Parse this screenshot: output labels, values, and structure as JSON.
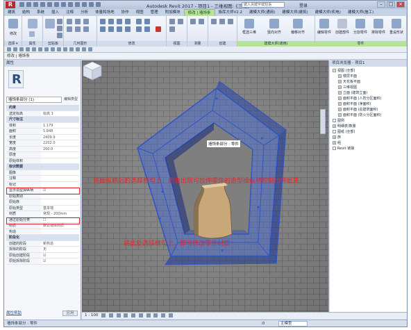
{
  "titlebar": {
    "logo": "R",
    "title": "Autodesk Revit 2017 - 项目1 - 三维视图: {三维}",
    "search_placeholder": "键入关键字或短语",
    "user": "登录",
    "min": "–",
    "max": "□",
    "close": "×"
  },
  "tabs": [
    {
      "label": "建筑",
      "active": false
    },
    {
      "label": "结构",
      "active": false
    },
    {
      "label": "系统",
      "active": false
    },
    {
      "label": "插入",
      "active": false
    },
    {
      "label": "注释",
      "active": false
    },
    {
      "label": "分析",
      "active": false
    },
    {
      "label": "体量和场地",
      "active": false
    },
    {
      "label": "协作",
      "active": false
    },
    {
      "label": "视图",
      "active": false
    },
    {
      "label": "管理",
      "active": false
    },
    {
      "label": "附加模块",
      "active": false
    },
    {
      "label": "修改 | 墙饰条",
      "active": true
    },
    {
      "label": "族库大师V2.2",
      "active": false
    },
    {
      "label": "建模大师(通用)",
      "active": false
    },
    {
      "label": "建模大师(建筑)",
      "active": false
    },
    {
      "label": "建模大师(机电)",
      "active": false
    },
    {
      "label": "建模大师(施工)",
      "active": false
    }
  ],
  "ribbon": {
    "groups": [
      {
        "title": "选择 ▾"
      },
      {
        "title": "属性"
      },
      {
        "title": "剪贴板"
      },
      {
        "title": "几何图形"
      },
      {
        "title": "修改"
      },
      {
        "title": "视图"
      },
      {
        "title": "测量"
      },
      {
        "title": "创建"
      },
      {
        "title": "建模大师(通用)"
      },
      {
        "title": "零件"
      }
    ],
    "labels": {
      "modify": "修改",
      "view_3d": "框选三维",
      "line_align": "竖向对齐",
      "flip": "偏移对齐",
      "create_part": "创建部件",
      "split": "分割零件",
      "divide": "排除零件",
      "restore": "重设形状",
      "edit_part": "编辑零件"
    }
  },
  "option_bar": {
    "label": "修改 | 墙饰条"
  },
  "properties": {
    "title": "属性",
    "close": "×",
    "logo": "R",
    "type_selector": "墙饰条部分 (1)",
    "edit_type": "编辑类型",
    "rows": [
      {
        "k": "约束",
        "v": "",
        "cat": true
      },
      {
        "k": "选定标高",
        "v": "标高 1",
        "cat": false
      },
      {
        "k": "尺寸标注",
        "v": "",
        "cat": true
      },
      {
        "k": "体积",
        "v": "1.179",
        "cat": false
      },
      {
        "k": "面积",
        "v": "5.848",
        "cat": false
      },
      {
        "k": "长度",
        "v": "2409.9",
        "cat": false
      },
      {
        "k": "宽度",
        "v": "2202.0",
        "cat": false
      },
      {
        "k": "高度",
        "v": "200.0",
        "cat": false
      },
      {
        "k": "厚度",
        "v": "",
        "cat": false
      },
      {
        "k": "原始体积",
        "v": "",
        "cat": false
      },
      {
        "k": "标识数据",
        "v": "",
        "cat": true
      },
      {
        "k": "图像",
        "v": "",
        "cat": false
      },
      {
        "k": "注释",
        "v": "",
        "cat": false
      },
      {
        "k": "标记",
        "v": "",
        "cat": false
      },
      {
        "k": "显示造型操纵柄",
        "v": "☑",
        "cat": false
      },
      {
        "k": "原始类别",
        "v": "",
        "cat": false
      },
      {
        "k": "原始族",
        "v": "",
        "cat": false
      },
      {
        "k": "原始类型",
        "v": "基本墙",
        "cat": false
      },
      {
        "k": "材质",
        "v": "常规 - 200mm",
        "cat": false
      },
      {
        "k": "通过原始分类",
        "v": "☐",
        "cat": false
      },
      {
        "k": "材质",
        "v": "默认墙体材质",
        "cat": false
      },
      {
        "k": "构造",
        "v": "",
        "cat": false
      },
      {
        "k": "阶段化",
        "v": "",
        "cat": true
      },
      {
        "k": "创建的阶段",
        "v": "新构造",
        "cat": false
      },
      {
        "k": "拆除的阶段",
        "v": "无",
        "cat": false
      },
      {
        "k": "原始创建阶段",
        "v": "☑",
        "cat": false
      },
      {
        "k": "原始拆除阶段",
        "v": "☑",
        "cat": false
      }
    ],
    "help_link": "属性帮助",
    "apply": "应用"
  },
  "viewport": {
    "tooltip": "墙饰条部分 : 零件",
    "note1": "将操纵柄后的选择框勾上，即会出现可拉伸零件的造型操纵柄控制拉伸出来",
    "note2": "将此处选择框勾上，即可修改零件材质",
    "viewcube_label": "前"
  },
  "browser": {
    "title": "项目浏览器 - 项目1",
    "close": "×",
    "items": [
      {
        "label": "视图 (全部)",
        "toggle": "−",
        "indent": 0
      },
      {
        "label": "楼层平面",
        "toggle": "+",
        "indent": 1
      },
      {
        "label": "天花板平面",
        "toggle": "+",
        "indent": 1
      },
      {
        "label": "三维视图",
        "toggle": "+",
        "indent": 1
      },
      {
        "label": "立面 (建筑立面)",
        "toggle": "+",
        "indent": 1
      },
      {
        "label": "面积平面 (人防分区面积)",
        "toggle": "+",
        "indent": 1
      },
      {
        "label": "面积平面 (净面积)",
        "toggle": "+",
        "indent": 1
      },
      {
        "label": "面积平面 (总建筑面积)",
        "toggle": "+",
        "indent": 1
      },
      {
        "label": "面积平面 (防火分区面积)",
        "toggle": "+",
        "indent": 1
      },
      {
        "label": "图例",
        "toggle": "",
        "indent": 0
      },
      {
        "label": "明细表/数量",
        "toggle": "+",
        "indent": 0
      },
      {
        "label": "图纸 (全部)",
        "toggle": "",
        "indent": 0
      },
      {
        "label": "族",
        "toggle": "+",
        "indent": 0
      },
      {
        "label": "组",
        "toggle": "+",
        "indent": 0
      },
      {
        "label": "Revit 链接",
        "toggle": "",
        "indent": 0
      }
    ]
  },
  "viewbar": {
    "scale": "1 : 100"
  },
  "status": {
    "text": "墙饰条部分 : 零件",
    "coord": ":0",
    "model": "主模型"
  },
  "colors": {
    "selection_blue": "#3c64d8",
    "annotation_red": "#e0262b",
    "wood": "#c8a878"
  }
}
